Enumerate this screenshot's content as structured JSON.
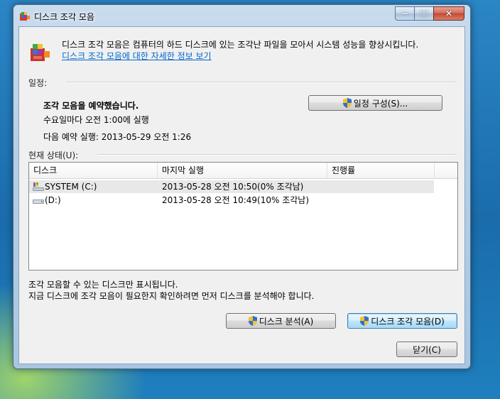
{
  "window": {
    "title": "디스크 조각 모음",
    "caption_min": "−",
    "caption_max": "□",
    "caption_close": "✕"
  },
  "header": {
    "description": "디스크 조각 모음은 컴퓨터의 하드 디스크에 있는 조각난 파일을 모아서 시스템 성능을 향상시킵니다.",
    "link": "디스크 조각 모음에 대한 자세한 정보 보기"
  },
  "schedule": {
    "label": "일정:",
    "status": "조각 모음을 예약했습니다.",
    "frequency": "수요일마다 오전 1:00에 실행",
    "next_run": "다음 예약 실행: 2013-05-29 오전 1:26",
    "configure_button": "일정 구성(S)..."
  },
  "current_status": {
    "label": "현재 상태(U):",
    "columns": [
      "디스크",
      "마지막 실행",
      "진행률"
    ],
    "rows": [
      {
        "disk": "SYSTEM (C:)",
        "last_run": "2013-05-28 오전 10:50(0% 조각남)",
        "progress": "",
        "icon": "system-drive-icon"
      },
      {
        "disk": "(D:)",
        "last_run": "2013-05-28 오전 10:49(10% 조각남)",
        "progress": "",
        "icon": "hard-drive-icon"
      }
    ]
  },
  "notes": {
    "line1": "조각 모음할 수 있는 디스크만 표시됩니다.",
    "line2": "지금 디스크에 조각 모음이 필요한지 확인하려면 먼저 디스크를 분석해야 합니다."
  },
  "actions": {
    "analyze_button": "디스크 분석(A)",
    "defrag_button": "디스크 조각 모음(D)",
    "close_button": "닫기(C)"
  },
  "colors": {
    "link": "#0066cc",
    "selection": "#e8e8e8",
    "default_button_border": "#3c7fb1"
  }
}
